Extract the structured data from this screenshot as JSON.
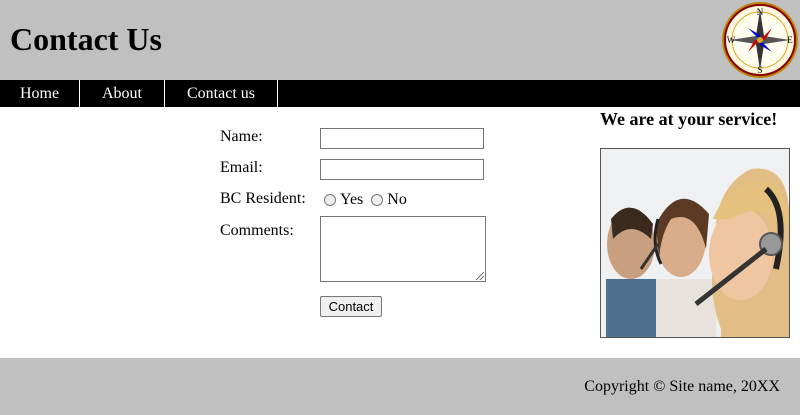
{
  "header": {
    "title": "Contact Us",
    "logo": {
      "icon": "compass-icon",
      "north": "N",
      "south": "S",
      "east": "E",
      "west": "W"
    }
  },
  "nav": {
    "items": [
      {
        "label": "Home"
      },
      {
        "label": "About"
      },
      {
        "label": "Contact us"
      }
    ]
  },
  "form": {
    "name_label": "Name:",
    "email_label": "Email:",
    "resident_label": "BC Resident:",
    "resident_options": [
      "Yes",
      "No"
    ],
    "comments_label": "Comments:",
    "name_value": "",
    "email_value": "",
    "comments_value": "",
    "submit_label": "Contact"
  },
  "aside": {
    "heading": "We are at your service!",
    "photo_icon": "call-center-agents-photo"
  },
  "footer": {
    "copyright": "Copyright © Site name, 20XX"
  },
  "colors": {
    "header_bg": "#c0c0c0",
    "nav_bg": "#000000",
    "nav_text": "#ffffff",
    "footer_bg": "#c0c0c0"
  }
}
